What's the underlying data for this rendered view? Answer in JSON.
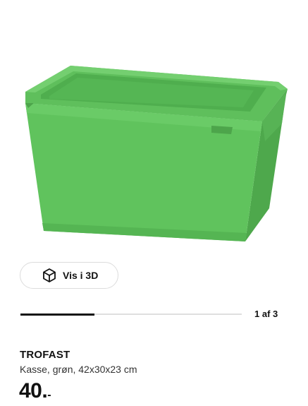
{
  "product": {
    "name": "TROFAST",
    "description": "Kasse, grøn, 42x30x23 cm",
    "price_main": "40.",
    "price_suffix": "-",
    "image_alt": "TROFAST green storage box",
    "color": "#5cc35f"
  },
  "viewer": {
    "view_3d_label": "Vis i 3D",
    "icon": "cube-icon"
  },
  "carousel": {
    "current": 1,
    "total": 3,
    "indicator_text": "1 af 3"
  }
}
